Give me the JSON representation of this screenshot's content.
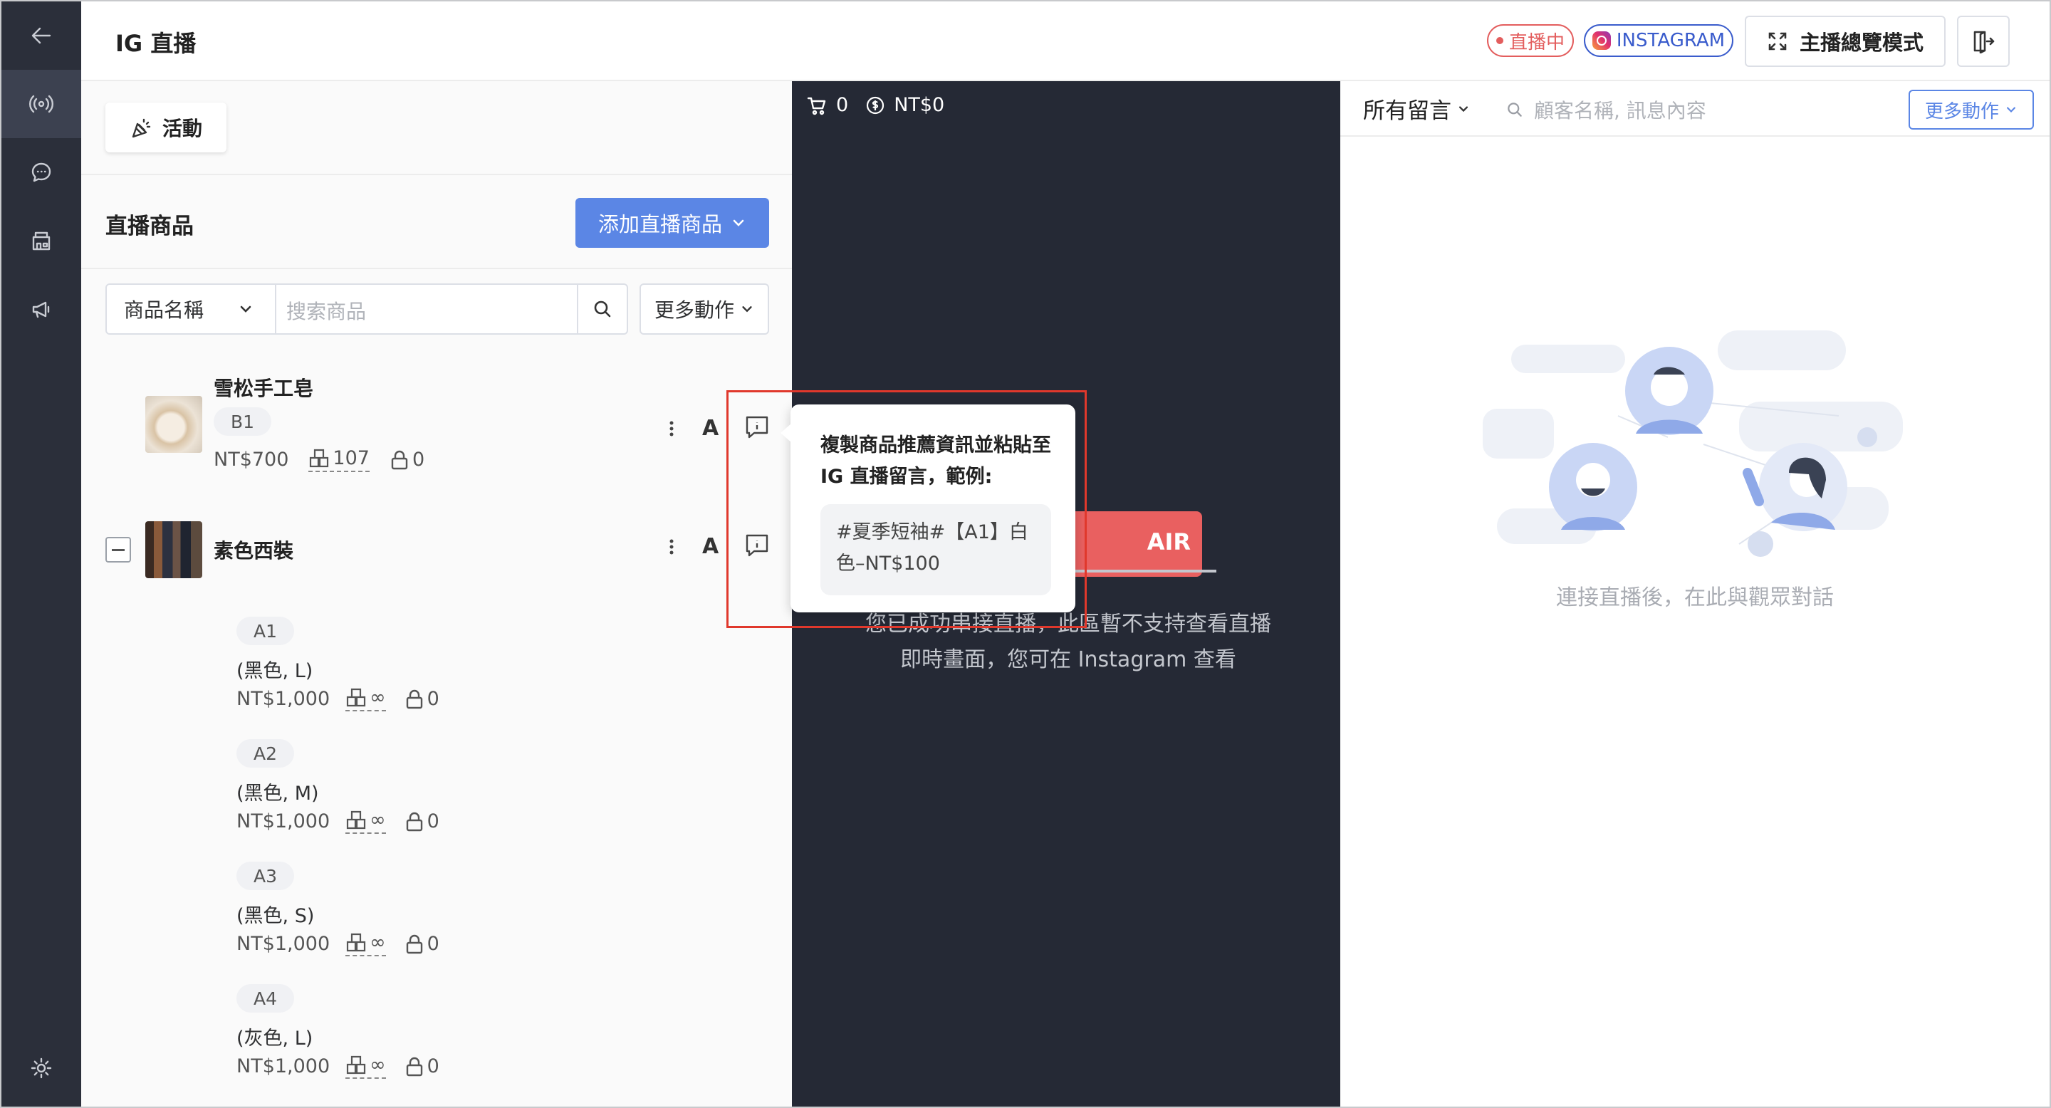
{
  "header": {
    "title": "IG 直播",
    "live_badge": "直播中",
    "platform_badge": "INSTAGRAM",
    "overview_button": "主播總覽模式"
  },
  "nav": {
    "items": [
      "back-icon",
      "broadcast-icon",
      "chat-icon",
      "store-icon",
      "megaphone-icon",
      "settings-icon"
    ],
    "active": "broadcast-icon"
  },
  "left": {
    "activity_button": "活動",
    "section_title": "直播商品",
    "add_button": "添加直播商品",
    "filter_field": "商品名稱",
    "search_placeholder": "搜索商品",
    "more_actions": "更多動作",
    "products": [
      {
        "name": "雪松手工皂",
        "sku": "B1",
        "price": "NT$700",
        "stock": "107",
        "locked": "0"
      },
      {
        "name": "素色西裝",
        "variants": [
          {
            "sku": "A1",
            "spec": "(黑色, L)",
            "price": "NT$1,000",
            "stock": "∞",
            "locked": "0"
          },
          {
            "sku": "A2",
            "spec": "(黑色, M)",
            "price": "NT$1,000",
            "stock": "∞",
            "locked": "0"
          },
          {
            "sku": "A3",
            "spec": "(黑色, S)",
            "price": "NT$1,000",
            "stock": "∞",
            "locked": "0"
          },
          {
            "sku": "A4",
            "spec": "(灰色, L)",
            "price": "NT$1,000",
            "stock": "∞",
            "locked": "0"
          }
        ]
      }
    ],
    "letter_label": "A"
  },
  "center": {
    "cart_count": "0",
    "revenue": "NT$0",
    "onair_text": "AIR",
    "message_line1": "您已成功串接直播，此區暫不支持查看直播",
    "message_line2": "即時畫面，您可在 Instagram 查看"
  },
  "tooltip": {
    "text": "複製商品推薦資訊並粘貼至 IG 直播留言，範例:",
    "example": "#夏季短袖#【A1】白色–NT$100"
  },
  "right": {
    "filter_label": "所有留言",
    "search_placeholder": "顧客名稱, 訊息內容",
    "more_actions": "更多動作",
    "empty_text": "連接直播後，在此與觀眾對話"
  },
  "colors": {
    "primary": "#5b86e5",
    "live": "#e35d5d",
    "nav_bg": "#2b2f3a",
    "center_bg": "#252935",
    "highlight": "#e0382c"
  }
}
